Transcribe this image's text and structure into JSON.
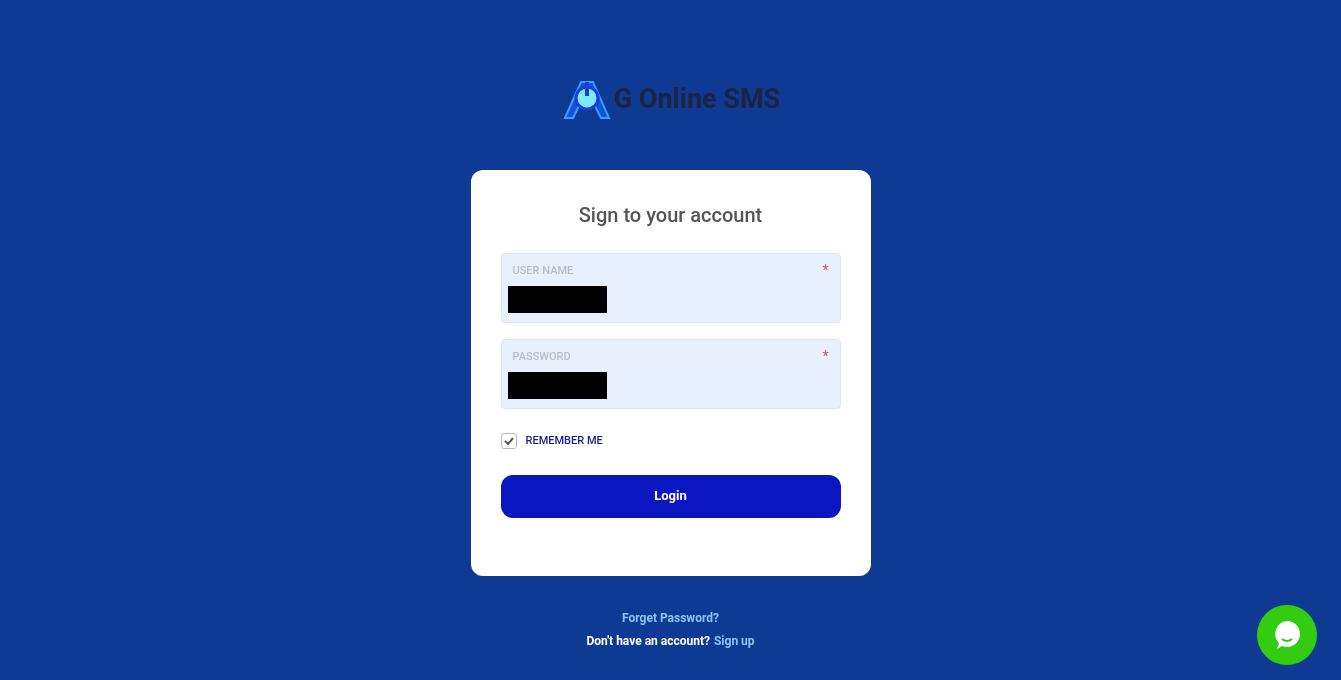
{
  "logo": {
    "text": "G Online SMS"
  },
  "card": {
    "title": "Sign to your account",
    "fields": [
      {
        "label": "USER NAME",
        "required_mark": "*",
        "redacted": true
      },
      {
        "label": "PASSWORD",
        "required_mark": "*",
        "redacted": true
      }
    ],
    "remember": {
      "label": "REMEMBER ME",
      "checked": true
    },
    "login_button": "Login"
  },
  "footer": {
    "forgot_link": "Forget Password?",
    "signup_prompt": "Don't have an account?",
    "signup_link": "Sign up"
  }
}
